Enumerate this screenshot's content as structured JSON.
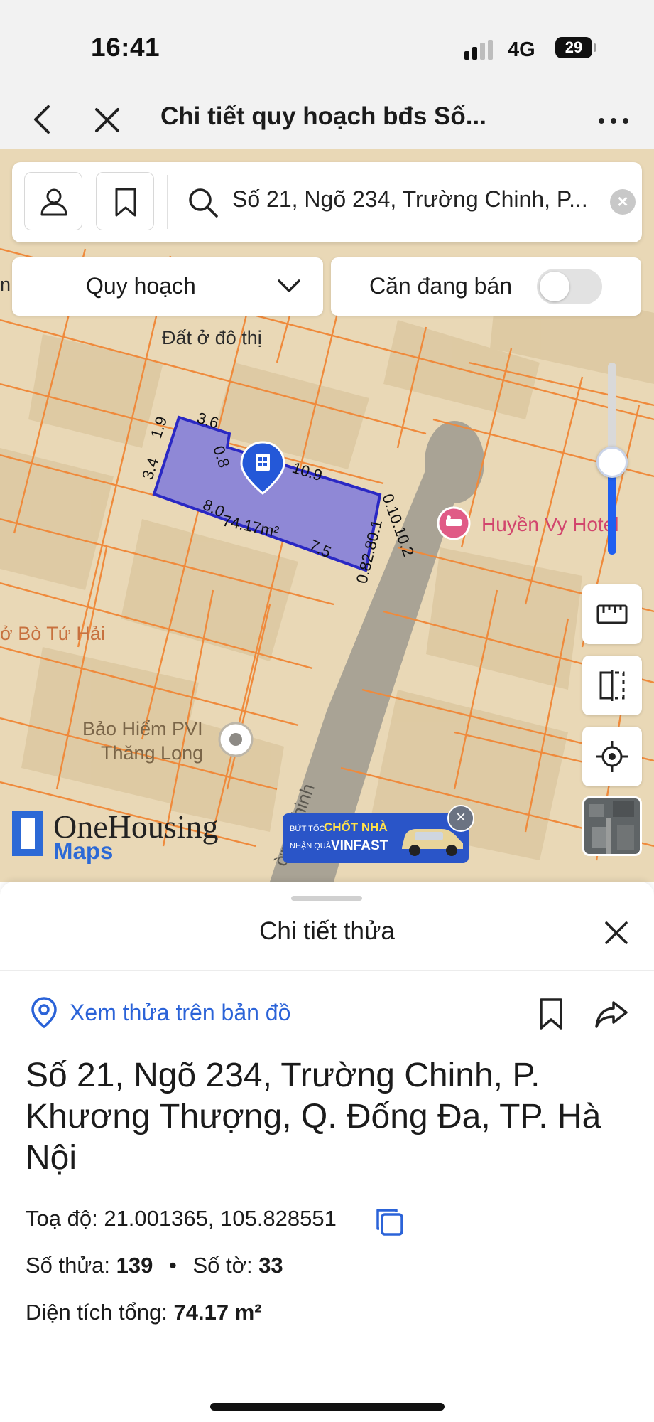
{
  "status_bar": {
    "time": "16:41",
    "network": "4G",
    "battery": "29"
  },
  "nav": {
    "title": "Chi tiết quy hoạch bđs Số...",
    "back_icon": "chevron-left-icon",
    "close_icon": "close-icon",
    "more_icon": "more-horizontal-icon"
  },
  "search": {
    "value": "Số 21, Ngõ 234, Trường Chinh, P...",
    "clear_label": "×"
  },
  "filters": {
    "layer_label": "Quy hoạch",
    "for_sale_label": "Căn đang bán",
    "for_sale_on": false
  },
  "map": {
    "zone_label": "Đất ở đô thị",
    "hotel_label": "Huyền Vy Hotel",
    "poi_left_label": "ở Bò Tứ Hải",
    "insurance_label_1": "Bảo Hiểm PVI",
    "insurance_label_2": "Thăng Long",
    "road_label": "ờng Chinh",
    "edge_label": "n",
    "parcel": {
      "area_label": "74.17m²",
      "edge_labels": [
        "3.6",
        "0.8",
        "1.9",
        "3.4",
        "10.9",
        "8.0",
        "7.5",
        "0.82.80.1",
        "0.10.10.2"
      ]
    },
    "zoom_level": 0.52,
    "colors": {
      "parcel_fill": "#8f88d6",
      "parcel_stroke": "#2a28c4",
      "boundary": "#ef8a3c",
      "road": "#a9a395",
      "accent": "#1f5ff0"
    }
  },
  "logo": {
    "name": "OneHousing",
    "sub": "Maps"
  },
  "ad": {
    "line1_small": "BỨT TỐC",
    "line1_big": "CHỐT NHÀ",
    "line2_small": "NHẬN QUÀ",
    "line2_big": "VINFAST"
  },
  "sheet": {
    "title": "Chi tiết thửa",
    "view_on_map_label": "Xem thửa trên bản đồ",
    "address": "Số 21, Ngõ 234, Trường Chinh, P. Khương Thượng, Q. Đống Đa, TP. Hà Nội",
    "coords_label": "Toạ độ:",
    "coords_value": "21.001365, 105.828551",
    "parcel_no_label": "Số thửa:",
    "parcel_no_value": "139",
    "separator": "•",
    "sheet_no_label": "Số tờ:",
    "sheet_no_value": "33",
    "area_label": "Diện tích tổng:",
    "area_value": "74.17 m²"
  }
}
